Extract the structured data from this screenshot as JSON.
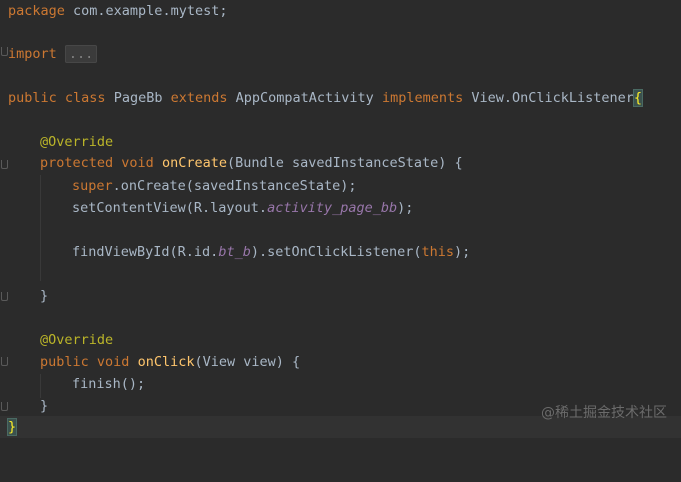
{
  "code": {
    "l1": {
      "kw": "package",
      "rest": " com.example.mytest;"
    },
    "l2": {
      "kw": "import",
      "fold": "..."
    },
    "l3": {
      "kw1": "public",
      "kw2": "class",
      "name": " PageBb ",
      "kw3": "extends",
      "base": " AppCompatActivity ",
      "kw4": "implements",
      "iface": " View.OnClickListener",
      "brace": "{"
    },
    "l4": {
      "ann": "@Override"
    },
    "l5": {
      "kw1": "protected",
      "kw2": "void",
      "fn": "onCreate",
      "rest": "(Bundle savedInstanceState) {"
    },
    "l6": {
      "kw": "super",
      "rest": ".onCreate(savedInstanceState);"
    },
    "l7": {
      "pre": "setContentView(R.layout.",
      "field": "activity_page_bb",
      "post": ");"
    },
    "l8": {
      "pre": "findViewById(R.id.",
      "field": "bt_b",
      "mid": ").setOnClickListener(",
      "kw": "this",
      "post": ");"
    },
    "l9": {
      "text": "}"
    },
    "l10": {
      "ann": "@Override"
    },
    "l11": {
      "kw1": "public",
      "kw2": "void",
      "fn": "onClick",
      "rest": "(View view) {"
    },
    "l12": {
      "text": "finish();"
    },
    "l13": {
      "text": "}"
    },
    "l14": {
      "brace": "}"
    }
  },
  "watermark": "@稀土掘金技术社区",
  "colors": {
    "background": "#2b2b2b",
    "keyword": "#cc7832",
    "annotation": "#bbb529",
    "method": "#ffc66d",
    "field": "#9876aa",
    "text": "#a9b7c6"
  }
}
